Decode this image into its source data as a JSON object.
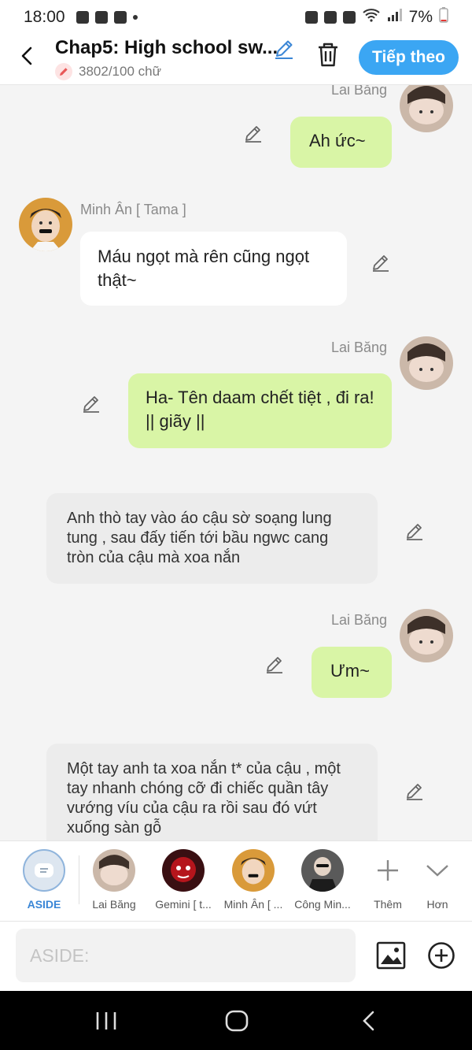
{
  "status_bar": {
    "time": "18:00",
    "battery": "7%"
  },
  "header": {
    "title": "Chap5: High school sw...",
    "word_count": "3802/100 chữ",
    "next_button": "Tiếp theo"
  },
  "messages": [
    {
      "sender": "Lai Băng",
      "text": "Ah ức~"
    },
    {
      "sender": "Minh Ân [ Tama ]",
      "text": "Máu ngọt mà rên cũng ngọt thật~"
    },
    {
      "sender": "Lai Băng",
      "text": "Ha- Tên daam chết tiệt , đi ra! || giãy ||"
    },
    {
      "text": "Anh thò tay vào áo cậu sờ soạng lung tung , sau đấy tiến tới bầu ngwc cang tròn của cậu mà xoa nắn"
    },
    {
      "sender": "Lai Băng",
      "text": "Ưm~"
    },
    {
      "text": "Một tay anh ta xoa nắn t* của cậu , một tay nhanh chóng cỡ đi chiếc quần tây vướng víu của cậu ra rồi sau đó vứt xuống sàn gỗ"
    }
  ],
  "characters": [
    {
      "label": "ASIDE"
    },
    {
      "label": "Lai Băng"
    },
    {
      "label": "Gemini [ t..."
    },
    {
      "label": "Minh Ân [ ..."
    },
    {
      "label": "Công Min..."
    },
    {
      "label": "Thêm"
    },
    {
      "label": "Hơn"
    }
  ],
  "input": {
    "placeholder": "ASIDE:"
  },
  "colors": {
    "accent": "#3ba6f3",
    "green_bubble": "#d9f5a6",
    "aside_bubble": "#ececec"
  },
  "icons": [
    "back-icon",
    "pencil-icon",
    "trash-icon",
    "image-icon",
    "plus-circle-icon"
  ]
}
